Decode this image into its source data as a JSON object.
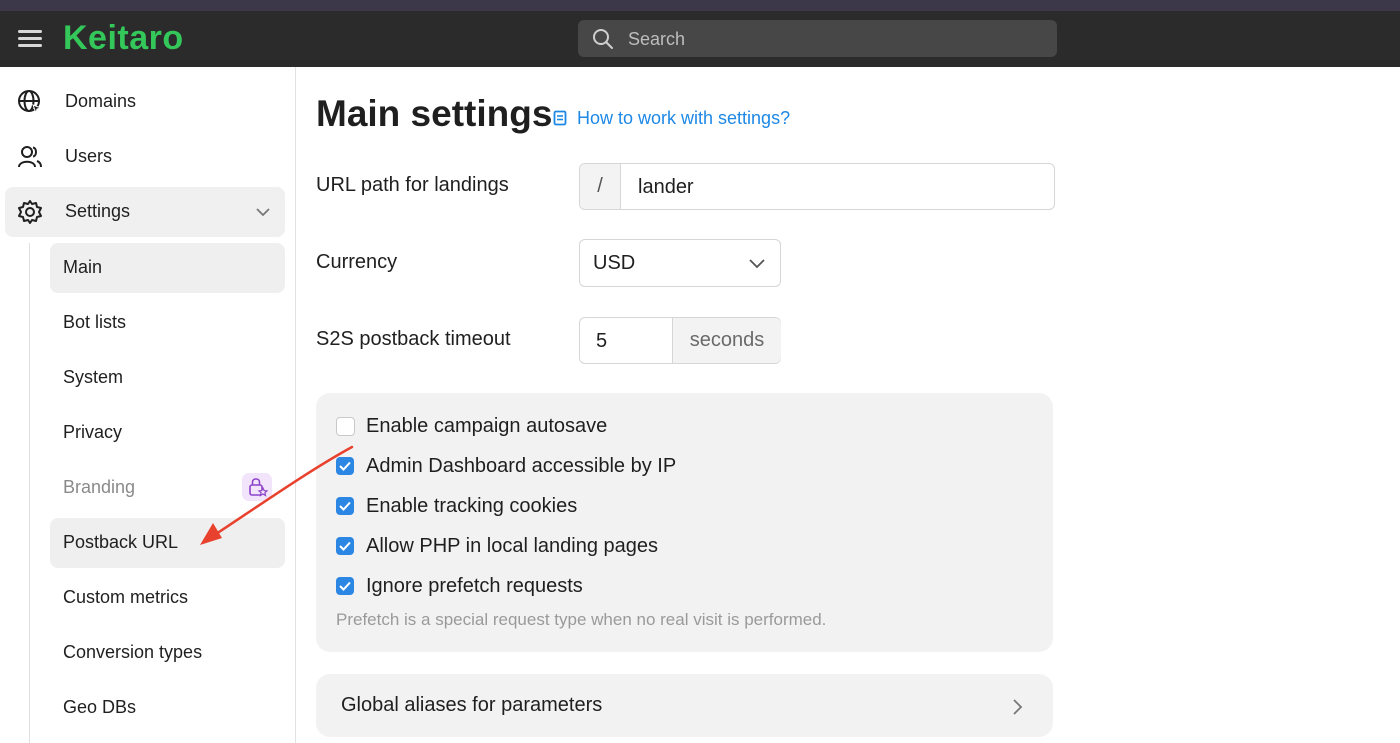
{
  "app": {
    "logo": "Keitaro"
  },
  "search": {
    "placeholder": "Search"
  },
  "sidebar": {
    "items": [
      {
        "label": "Domains",
        "icon": "globe-icon"
      },
      {
        "label": "Users",
        "icon": "users-icon"
      },
      {
        "label": "Settings",
        "icon": "gear-icon",
        "expanded": true
      }
    ],
    "settings_submenu": [
      {
        "label": "Main",
        "active": true
      },
      {
        "label": "Bot lists"
      },
      {
        "label": "System"
      },
      {
        "label": "Privacy"
      },
      {
        "label": "Branding",
        "locked": true
      },
      {
        "label": "Postback URL",
        "highlighted": true
      },
      {
        "label": "Custom metrics"
      },
      {
        "label": "Conversion types"
      },
      {
        "label": "Geo DBs"
      }
    ]
  },
  "main": {
    "title": "Main settings",
    "help_link": "How to work with settings?",
    "fields": {
      "url_path": {
        "label": "URL path for landings",
        "prefix": "/",
        "value": "lander"
      },
      "currency": {
        "label": "Currency",
        "value": "USD"
      },
      "timeout": {
        "label": "S2S postback timeout",
        "value": "5",
        "suffix": "seconds"
      }
    },
    "checkboxes": [
      {
        "label": "Enable campaign autosave",
        "checked": false
      },
      {
        "label": "Admin Dashboard accessible by IP",
        "checked": true
      },
      {
        "label": "Enable tracking cookies",
        "checked": true
      },
      {
        "label": "Allow PHP in local landing pages",
        "checked": true
      },
      {
        "label": "Ignore prefetch requests",
        "checked": true
      }
    ],
    "prefetch_hint": "Prefetch is a special request type when no real visit is performed.",
    "accordion": {
      "label": "Global aliases for parameters"
    }
  },
  "colors": {
    "accent": "#2b87e3",
    "logo": "#34c759",
    "annotation_arrow": "#e8412e",
    "topbar": "#2b2b2b"
  }
}
